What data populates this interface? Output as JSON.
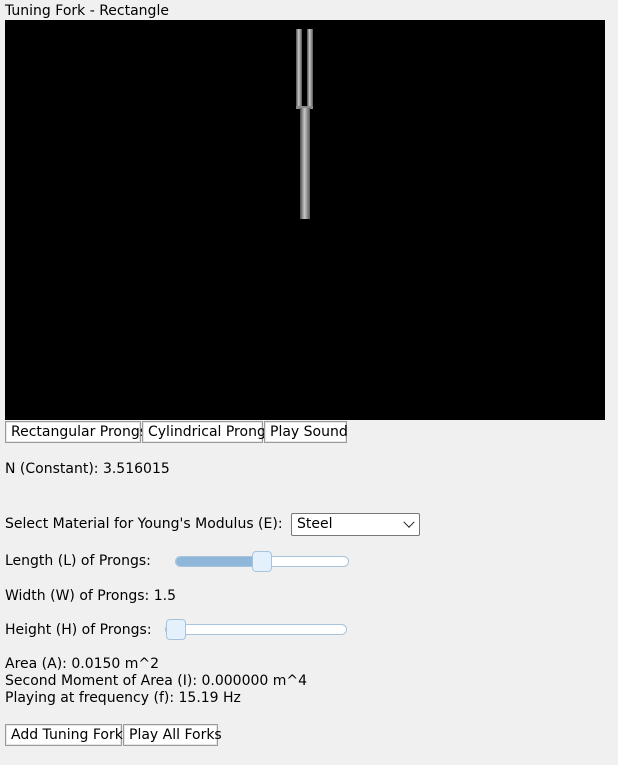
{
  "window": {
    "title": "Tuning Fork - Rectangle"
  },
  "buttons": {
    "rectangular": "Rectangular Prongs",
    "cylindrical": "Cylindrical Prongs",
    "play_sound": "Play Sound",
    "add_fork": "Add Tuning Fork",
    "play_all": "Play All Forks"
  },
  "constant": {
    "text": "N (Constant): 3.516015"
  },
  "material": {
    "label": "Select Material for Young's Modulus (E):",
    "selected": "Steel"
  },
  "length": {
    "label": "Length (L) of Prongs:",
    "level": 0.5
  },
  "width": {
    "text": "Width (W) of Prongs: 1.5"
  },
  "height": {
    "label": "Height (H) of Prongs:",
    "level": 0.0
  },
  "results": {
    "area": "Area (A): 0.0150 m^2",
    "moment": "Second Moment of Area (I): 0.000000 m^4",
    "frequency": "Playing at frequency (f): 15.19 Hz"
  }
}
